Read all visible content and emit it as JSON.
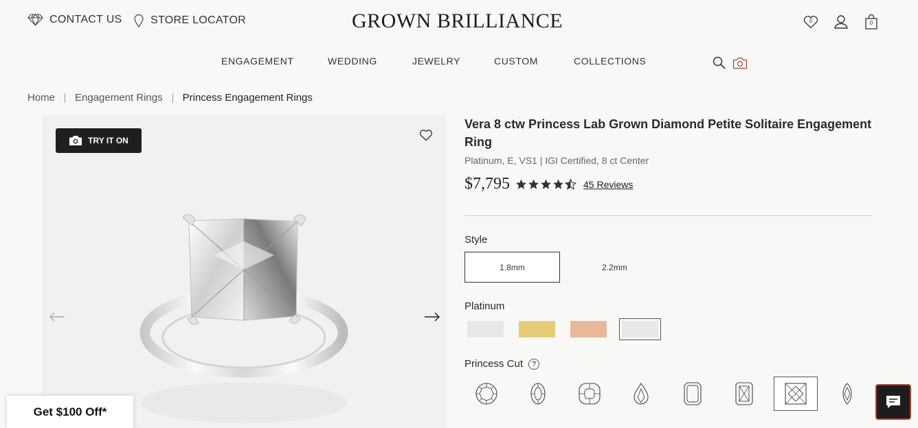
{
  "header": {
    "contact_label": "CONTACT US",
    "store_label": "STORE LOCATOR",
    "logo": "GROWN BRILLIANCE",
    "wishlist_count": "0",
    "cart_count": "0",
    "icons": [
      "diamond-icon",
      "location-pin-icon",
      "heart-icon",
      "user-icon",
      "shopping-bag-icon"
    ]
  },
  "nav": {
    "items": [
      "ENGAGEMENT",
      "WEDDING",
      "JEWELRY",
      "CUSTOM",
      "COLLECTIONS"
    ],
    "icons": [
      "search-icon",
      "camera-icon"
    ]
  },
  "breadcrumb": [
    "Home",
    "Engagement Rings",
    "Princess Engagement Rings"
  ],
  "gallery": {
    "try_on_label": "TRY IT ON"
  },
  "product": {
    "title": "Vera 8 ctw Princess Lab Grown Diamond Petite Solitaire Engagement Ring",
    "subtitle": "Platinum, E, VS1 | IGI Certified, 8 ct Center",
    "price": "$7,795",
    "rating": 4.5,
    "reviews_label": "45 Reviews"
  },
  "style": {
    "label": "Style",
    "options": [
      "1.8mm",
      "2.2mm"
    ],
    "selected": "1.8mm"
  },
  "metal": {
    "label": "Platinum",
    "swatches": [
      "#e8e8e8",
      "#e6cc78",
      "#e8b898",
      "#e8e8e8"
    ],
    "selected_index": 3
  },
  "shape": {
    "label": "Princess Cut",
    "help": "?",
    "options": [
      "round-diamond-icon",
      "oval-diamond-icon",
      "cushion-diamond-icon",
      "pear-diamond-icon",
      "emerald-diamond-icon",
      "radiant-diamond-icon",
      "princess-diamond-icon",
      "marquise-diamond-icon"
    ],
    "selected": "princess-diamond-icon"
  },
  "promo": {
    "label": "Get $100 Off*"
  },
  "chat": {
    "icon": "chat-icon"
  },
  "colors": {
    "accent": "#b14a35",
    "text": "#2b2b2b",
    "background": "#f8f8f6"
  }
}
